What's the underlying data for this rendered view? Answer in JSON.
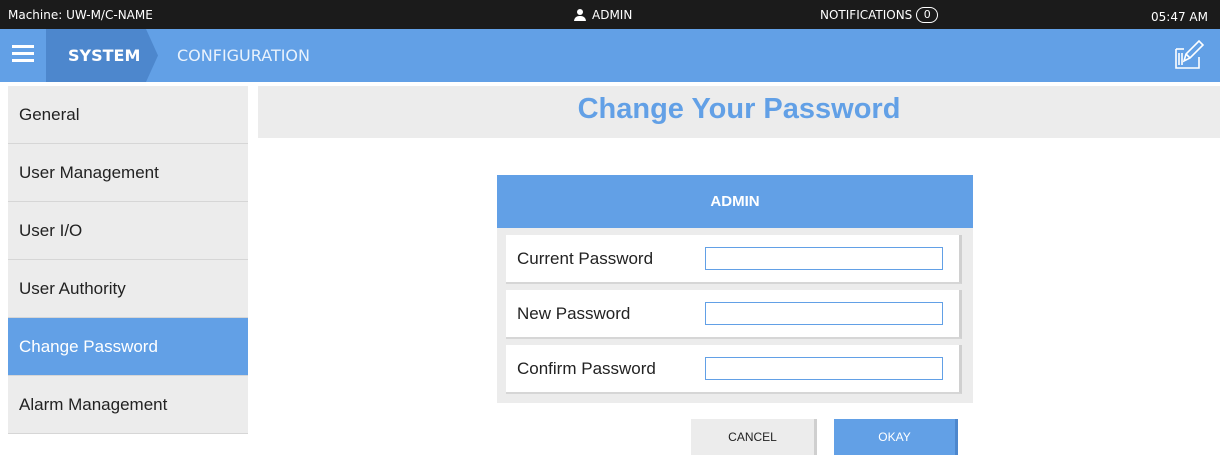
{
  "statusbar": {
    "machine": "Machine: UW-M/C-NAME",
    "user": "ADMIN",
    "notifications_label": "NOTIFICATIONS",
    "notifications_count": "0",
    "time": "05:47 AM"
  },
  "navbar": {
    "crumb_system": "SYSTEM",
    "crumb_config": "CONFIGURATION",
    "menu_icon": "hamburger-menu-icon",
    "edit_icon": "edit-icon"
  },
  "sidebar": {
    "items": [
      {
        "label": "General"
      },
      {
        "label": "User Management"
      },
      {
        "label": "User I/O"
      },
      {
        "label": "User Authority"
      },
      {
        "label": "Change Password",
        "active": true
      },
      {
        "label": "Alarm Management"
      }
    ]
  },
  "main": {
    "title": "Change Your Password",
    "panel_header": "ADMIN",
    "fields": {
      "current_password": {
        "label": "Current Password",
        "value": ""
      },
      "new_password": {
        "label": "New Password",
        "value": ""
      },
      "confirm_password": {
        "label": "Confirm Password",
        "value": ""
      }
    },
    "cancel_label": "CANCEL",
    "okay_label": "OKAY"
  },
  "colors": {
    "accent": "#62a0e6",
    "accent_dark": "#4d87cd",
    "status_bar": "#1b1b1b",
    "panel_bg": "#ececec"
  }
}
